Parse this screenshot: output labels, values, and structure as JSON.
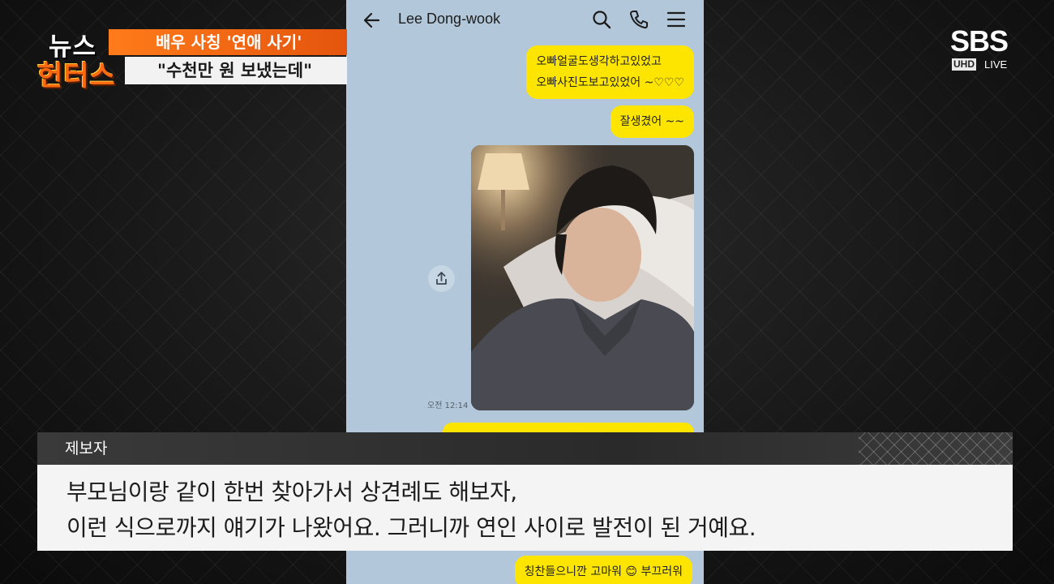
{
  "broadcast": {
    "program_logo_top": "뉴스",
    "program_logo_bottom": "헌터스",
    "headline_top": "배우 사칭 '연애 사기'",
    "headline_bottom": "\"수천만 원 보냈는데\"",
    "channel": "SBS",
    "channel_uhd": "UHD",
    "channel_live": "LIVE"
  },
  "chat": {
    "contact_name": "Lee Dong-wook",
    "messages": [
      {
        "lines": [
          "오빠얼굴도생각하고있었고",
          "오빠사진도보고있었어 ~♡♡♡"
        ]
      },
      {
        "text": "잘생겼어 ~~"
      },
      {
        "text": "칭찬들으니깐 고마워 😊 부끄러워"
      }
    ],
    "photo_time": "오전 12:14",
    "icons": [
      "back-arrow-icon",
      "search-icon",
      "phone-icon",
      "menu-icon",
      "share-icon"
    ],
    "bubble_color": "#fee500",
    "chat_bg_color": "#b2c7d9"
  },
  "caption": {
    "speaker": "제보자",
    "line1": "부모님이랑 같이 한번 찾아가서 상견례도 해보자,",
    "line2": "이런 식으로까지 얘기가 나왔어요. 그러니까 연인 사이로 발전이 된 거예요."
  }
}
